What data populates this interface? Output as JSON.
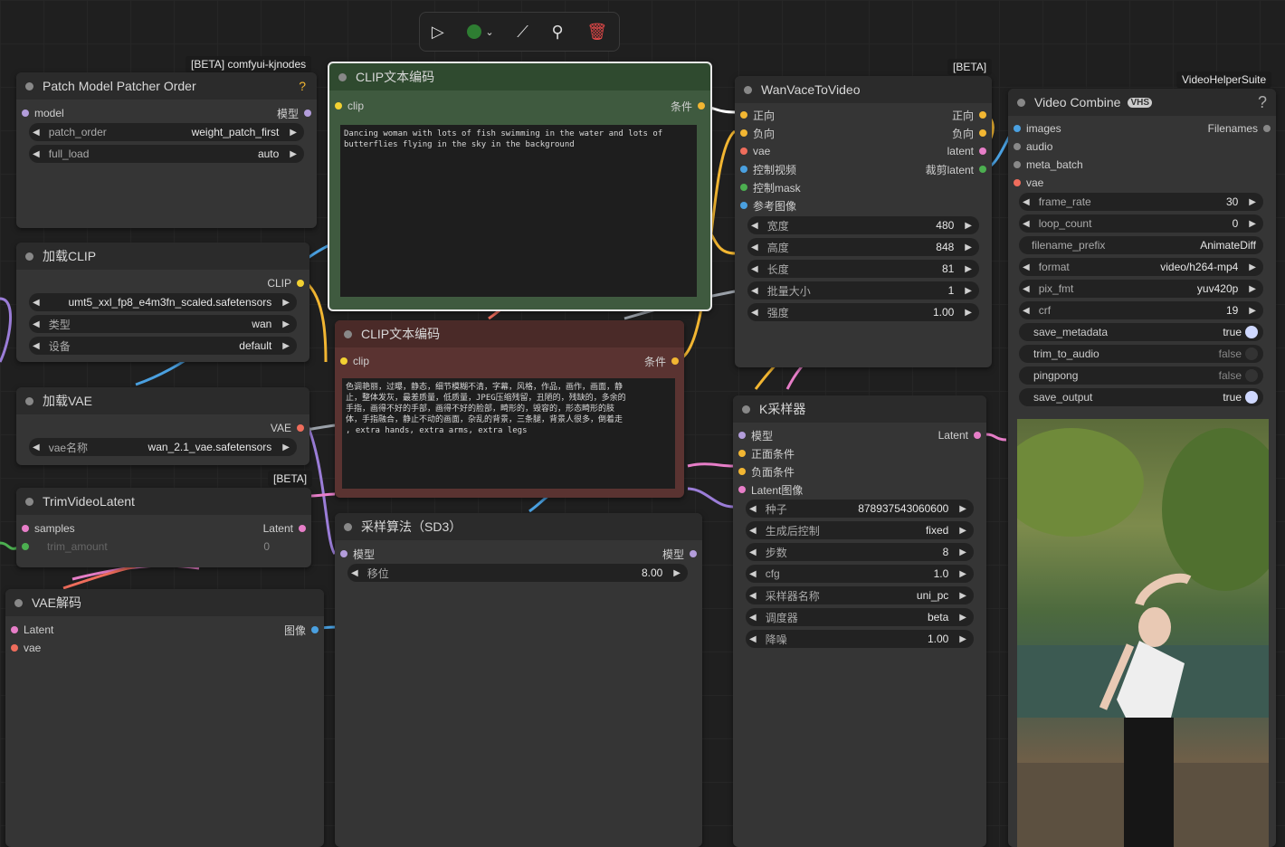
{
  "toolbar": {
    "run_icon": "play-icon",
    "status_color": "#2e7d32",
    "link_icon": "link-icon",
    "pin_icon": "pin-icon",
    "delete_icon": "trash-icon"
  },
  "badges": {
    "kjnodes": "[BETA] comfyui-kjnodes",
    "wan_beta": "[BETA]",
    "vhs": "VideoHelperSuite",
    "trim_beta": "[BETA]"
  },
  "patch": {
    "title": "Patch Model Patcher Order",
    "help": "?",
    "in_model": "model",
    "out_model": "模型",
    "w1_label": "patch_order",
    "w1_value": "weight_patch_first",
    "w2_label": "full_load",
    "w2_value": "auto"
  },
  "loadclip": {
    "title": "加载CLIP",
    "out_clip": "CLIP",
    "w1_value": "umt5_xxl_fp8_e4m3fn_scaled.safetensors",
    "w2_label": "类型",
    "w2_value": "wan",
    "w3_label": "设备",
    "w3_value": "default"
  },
  "loadvae": {
    "title": "加载VAE",
    "out_vae": "VAE",
    "w1_label": "vae名称",
    "w1_value": "wan_2.1_vae.safetensors"
  },
  "trim": {
    "title": "TrimVideoLatent",
    "in_samples": "samples",
    "out_latent": "Latent",
    "w1_label": "trim_amount",
    "w1_value": "0"
  },
  "vaedecode": {
    "title": "VAE解码",
    "in_latent": "Latent",
    "in_vae": "vae",
    "out_image": "图像"
  },
  "clip_pos": {
    "title": "CLIP文本编码",
    "in_clip": "clip",
    "out_cond": "条件",
    "text": "Dancing woman with lots of fish swimming in the water and lots of\nbutterflies flying in the sky in the background"
  },
  "clip_neg": {
    "title": "CLIP文本编码",
    "in_clip": "clip",
    "out_cond": "条件",
    "text": "色调艳丽，过曝，静态，细节模糊不清，字幕，风格，作品，画作，画面，静\n止，整体发灰，最差质量，低质量，JPEG压缩残留，丑陋的，残缺的，多余的\n手指，画得不好的手部，画得不好的脸部，畸形的，毁容的，形态畸形的肢\n体，手指融合，静止不动的画面，杂乱的背景，三条腿，背景人很多，倒着走\n, extra hands, extra arms, extra legs"
  },
  "sd3": {
    "title": "采样算法（SD3）",
    "in_model": "模型",
    "out_model": "模型",
    "w1_label": "移位",
    "w1_value": "8.00"
  },
  "wan": {
    "title": "WanVaceToVideo",
    "in": [
      "正向",
      "负向",
      "vae",
      "控制视频",
      "控制mask",
      "参考图像"
    ],
    "out": [
      "正向",
      "负向",
      "latent",
      "裁剪latent"
    ],
    "widgets": [
      {
        "label": "宽度",
        "value": "480"
      },
      {
        "label": "高度",
        "value": "848"
      },
      {
        "label": "长度",
        "value": "81"
      },
      {
        "label": "批量大小",
        "value": "1"
      },
      {
        "label": "强度",
        "value": "1.00"
      }
    ]
  },
  "ksampler": {
    "title": "K采样器",
    "in": [
      "模型",
      "正面条件",
      "负面条件",
      "Latent图像"
    ],
    "out_latent": "Latent",
    "widgets": [
      {
        "label": "种子",
        "value": "878937543060600"
      },
      {
        "label": "生成后控制",
        "value": "fixed"
      },
      {
        "label": "步数",
        "value": "8"
      },
      {
        "label": "cfg",
        "value": "1.0"
      },
      {
        "label": "采样器名称",
        "value": "uni_pc"
      },
      {
        "label": "调度器",
        "value": "beta"
      },
      {
        "label": "降噪",
        "value": "1.00"
      }
    ]
  },
  "vcombine": {
    "title": "Video Combine",
    "logo": "VHS",
    "help": "?",
    "in": [
      "images",
      "audio",
      "meta_batch",
      "vae"
    ],
    "out_filenames": "Filenames",
    "widgets": [
      {
        "label": "frame_rate",
        "value": "30"
      },
      {
        "label": "loop_count",
        "value": "0"
      },
      {
        "label": "filename_prefix",
        "value": "AnimateDiff"
      },
      {
        "label": "format",
        "value": "video/h264-mp4"
      },
      {
        "label": "pix_fmt",
        "value": "yuv420p"
      },
      {
        "label": "crf",
        "value": "19"
      }
    ],
    "toggles": [
      {
        "label": "save_metadata",
        "value": "true"
      },
      {
        "label": "trim_to_audio",
        "value": "false"
      },
      {
        "label": "pingpong",
        "value": "false"
      },
      {
        "label": "save_output",
        "value": "true"
      }
    ]
  }
}
